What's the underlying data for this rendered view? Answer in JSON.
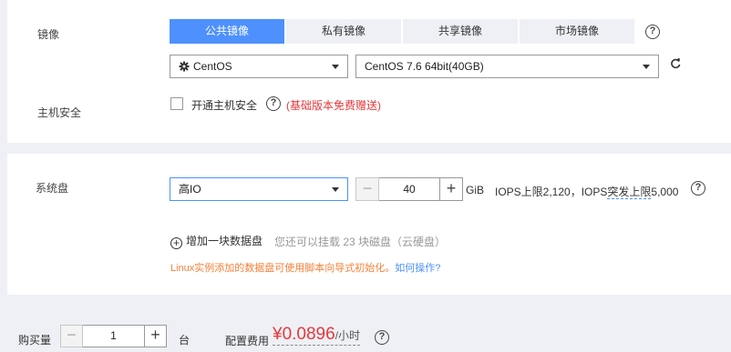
{
  "image_section": {
    "label": "镜像",
    "tabs": [
      "公共镜像",
      "私有镜像",
      "共享镜像",
      "市场镜像"
    ],
    "os_select": "CentOS",
    "version_select": "CentOS 7.6 64bit(40GB)"
  },
  "host_security": {
    "label": "主机安全",
    "checkbox_label": "开通主机安全",
    "note": "(基础版本免费赠送)"
  },
  "system_disk": {
    "label": "系统盘",
    "type_select": "高IO",
    "size_value": "40",
    "unit": "GiB",
    "iops_text": "IOPS上限2,120，IOPS",
    "iops_burst": "突发上限",
    "iops_burst_value": "5,000",
    "add_disk_label": "增加一块数据盘",
    "add_disk_hint": "您还可以挂载 23 块磁盘（云硬盘）",
    "init_note": "Linux实例添加的数据盘可使用脚本向导式初始化。",
    "init_link": "如何操作?"
  },
  "footer": {
    "quantity_label": "购买量",
    "quantity_value": "1",
    "quantity_unit": "台",
    "price_label": "配置费用",
    "price_value": "¥0.0896",
    "price_unit": "/小时"
  },
  "colors": {
    "accent": "#4d90fe",
    "price": "#e4393c",
    "note": "#f5813a"
  }
}
